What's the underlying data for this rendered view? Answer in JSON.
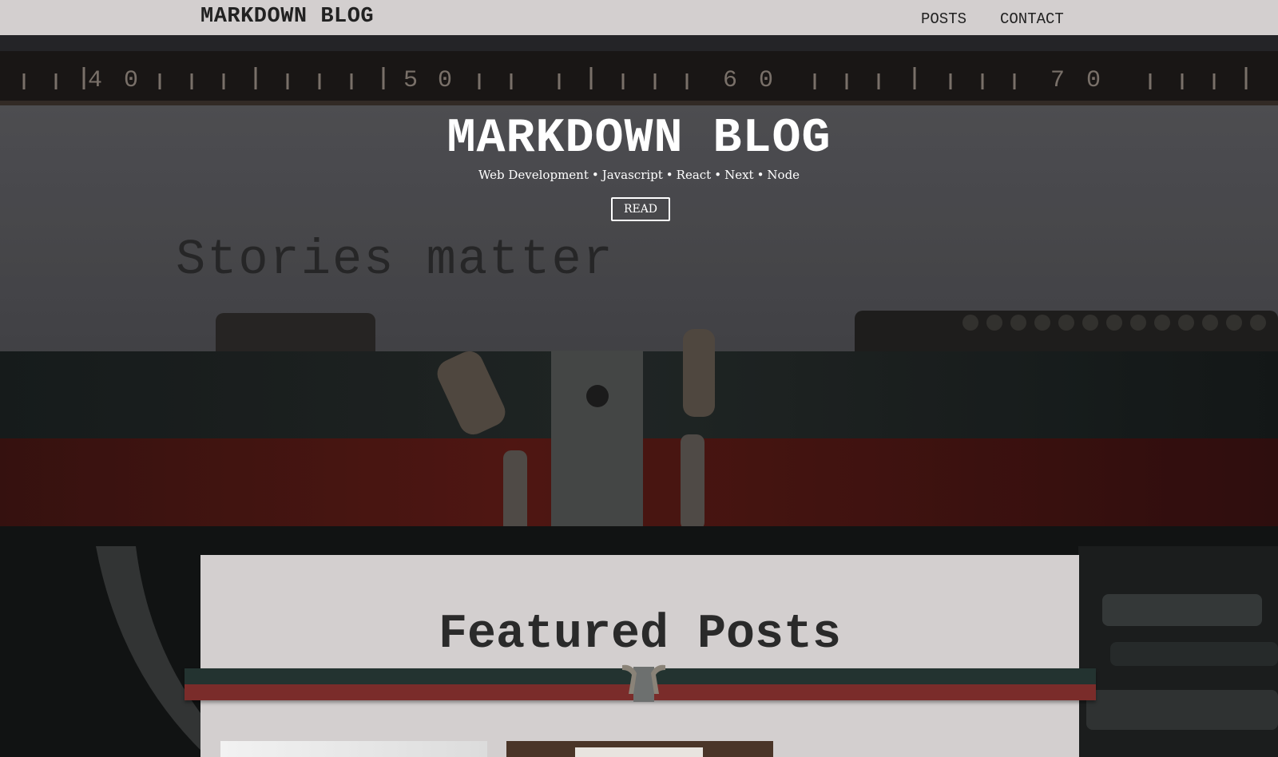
{
  "nav": {
    "brand": "MARKDOWN BLOG",
    "links": [
      "POSTS",
      "CONTACT"
    ]
  },
  "hero": {
    "title": "MARKDOWN BLOG",
    "subtitle_items": [
      "Web Development",
      "Javascript",
      "React",
      "Next",
      "Node"
    ],
    "subtitle_separator": "•",
    "read_label": "READ",
    "typed_text": "Stories matter",
    "ruler_numbers": [
      "4",
      "0",
      "5",
      "0",
      "6",
      "0",
      "7",
      "0"
    ]
  },
  "featured": {
    "title": "Featured Posts"
  },
  "colors": {
    "nav_bg": "#d3cfcf",
    "ribbon_dark": "#233330",
    "ribbon_red": "#7a2c2a",
    "text_dark": "#222222"
  }
}
